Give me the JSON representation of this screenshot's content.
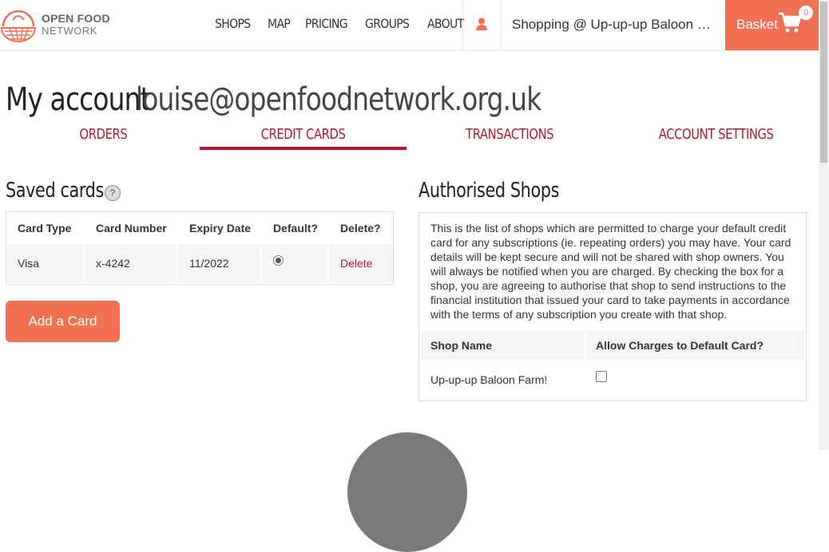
{
  "header": {
    "logo": {
      "line1": "OPEN FOOD",
      "line2": "NETWORK"
    },
    "nav": [
      "SHOPS",
      "MAP",
      "PRICING",
      "GROUPS",
      "ABOUT"
    ],
    "shop_label": "Shopping @ Up-up-up Baloon Farm!",
    "basket_label": "Basket",
    "basket_count": "0"
  },
  "page": {
    "title_prefix": "My account",
    "email": "louise@openfoodnetwork.org.uk"
  },
  "tabs": [
    "ORDERS",
    "CREDIT CARDS",
    "TRANSACTIONS",
    "ACCOUNT SETTINGS"
  ],
  "active_tab": "CREDIT CARDS",
  "saved_cards": {
    "heading": "Saved cards",
    "help": "?",
    "columns": [
      "Card Type",
      "Card Number",
      "Expiry Date",
      "Default?",
      "Delete?"
    ],
    "rows": [
      {
        "type": "Visa",
        "number": "x-4242",
        "expiry": "11/2022",
        "default": true,
        "delete": "Delete"
      }
    ],
    "add_button": "Add a Card"
  },
  "authorised_shops": {
    "heading": "Authorised Shops",
    "description": "This is the list of shops which are permitted to charge your default credit card for any subscriptions (ie. repeating orders) you may have. Your card details will be kept secure and will not be shared with shop owners. You will always be notified when you are charged. By checking the box for a shop, you are agreeing to authorise that shop to send instructions to the financial institution that issued your card to take payments in accordance with the terms of any subscription you create with that shop.",
    "columns": [
      "Shop Name",
      "Allow Charges to Default Card?"
    ],
    "rows": [
      {
        "shop": "Up-up-up Baloon Farm!",
        "allowed": false
      }
    ]
  },
  "colors": {
    "accent": "#f27052",
    "tab_red": "#b5172f"
  }
}
